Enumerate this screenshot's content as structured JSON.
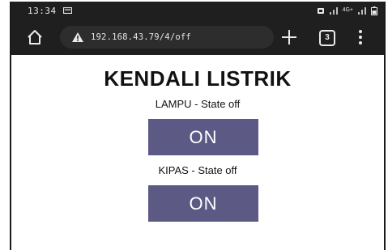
{
  "status_bar": {
    "time": "13:34",
    "network_label": "4G+"
  },
  "browser": {
    "url": "192.168.43.79/4/off",
    "tab_count": "3",
    "icons": [
      "home-icon",
      "warning-icon",
      "plus-icon",
      "tabs-icon",
      "menu-icon"
    ]
  },
  "page": {
    "title": "KENDALI LISTRIK",
    "devices": [
      {
        "label": "LAMPU - State off",
        "button_label": "ON"
      },
      {
        "label": "KIPAS - State off",
        "button_label": "ON"
      }
    ]
  },
  "colors": {
    "button_bg": "#5c5a85",
    "chrome_bg": "#1f1f1f",
    "omnibox_bg": "#2d2d2d"
  }
}
